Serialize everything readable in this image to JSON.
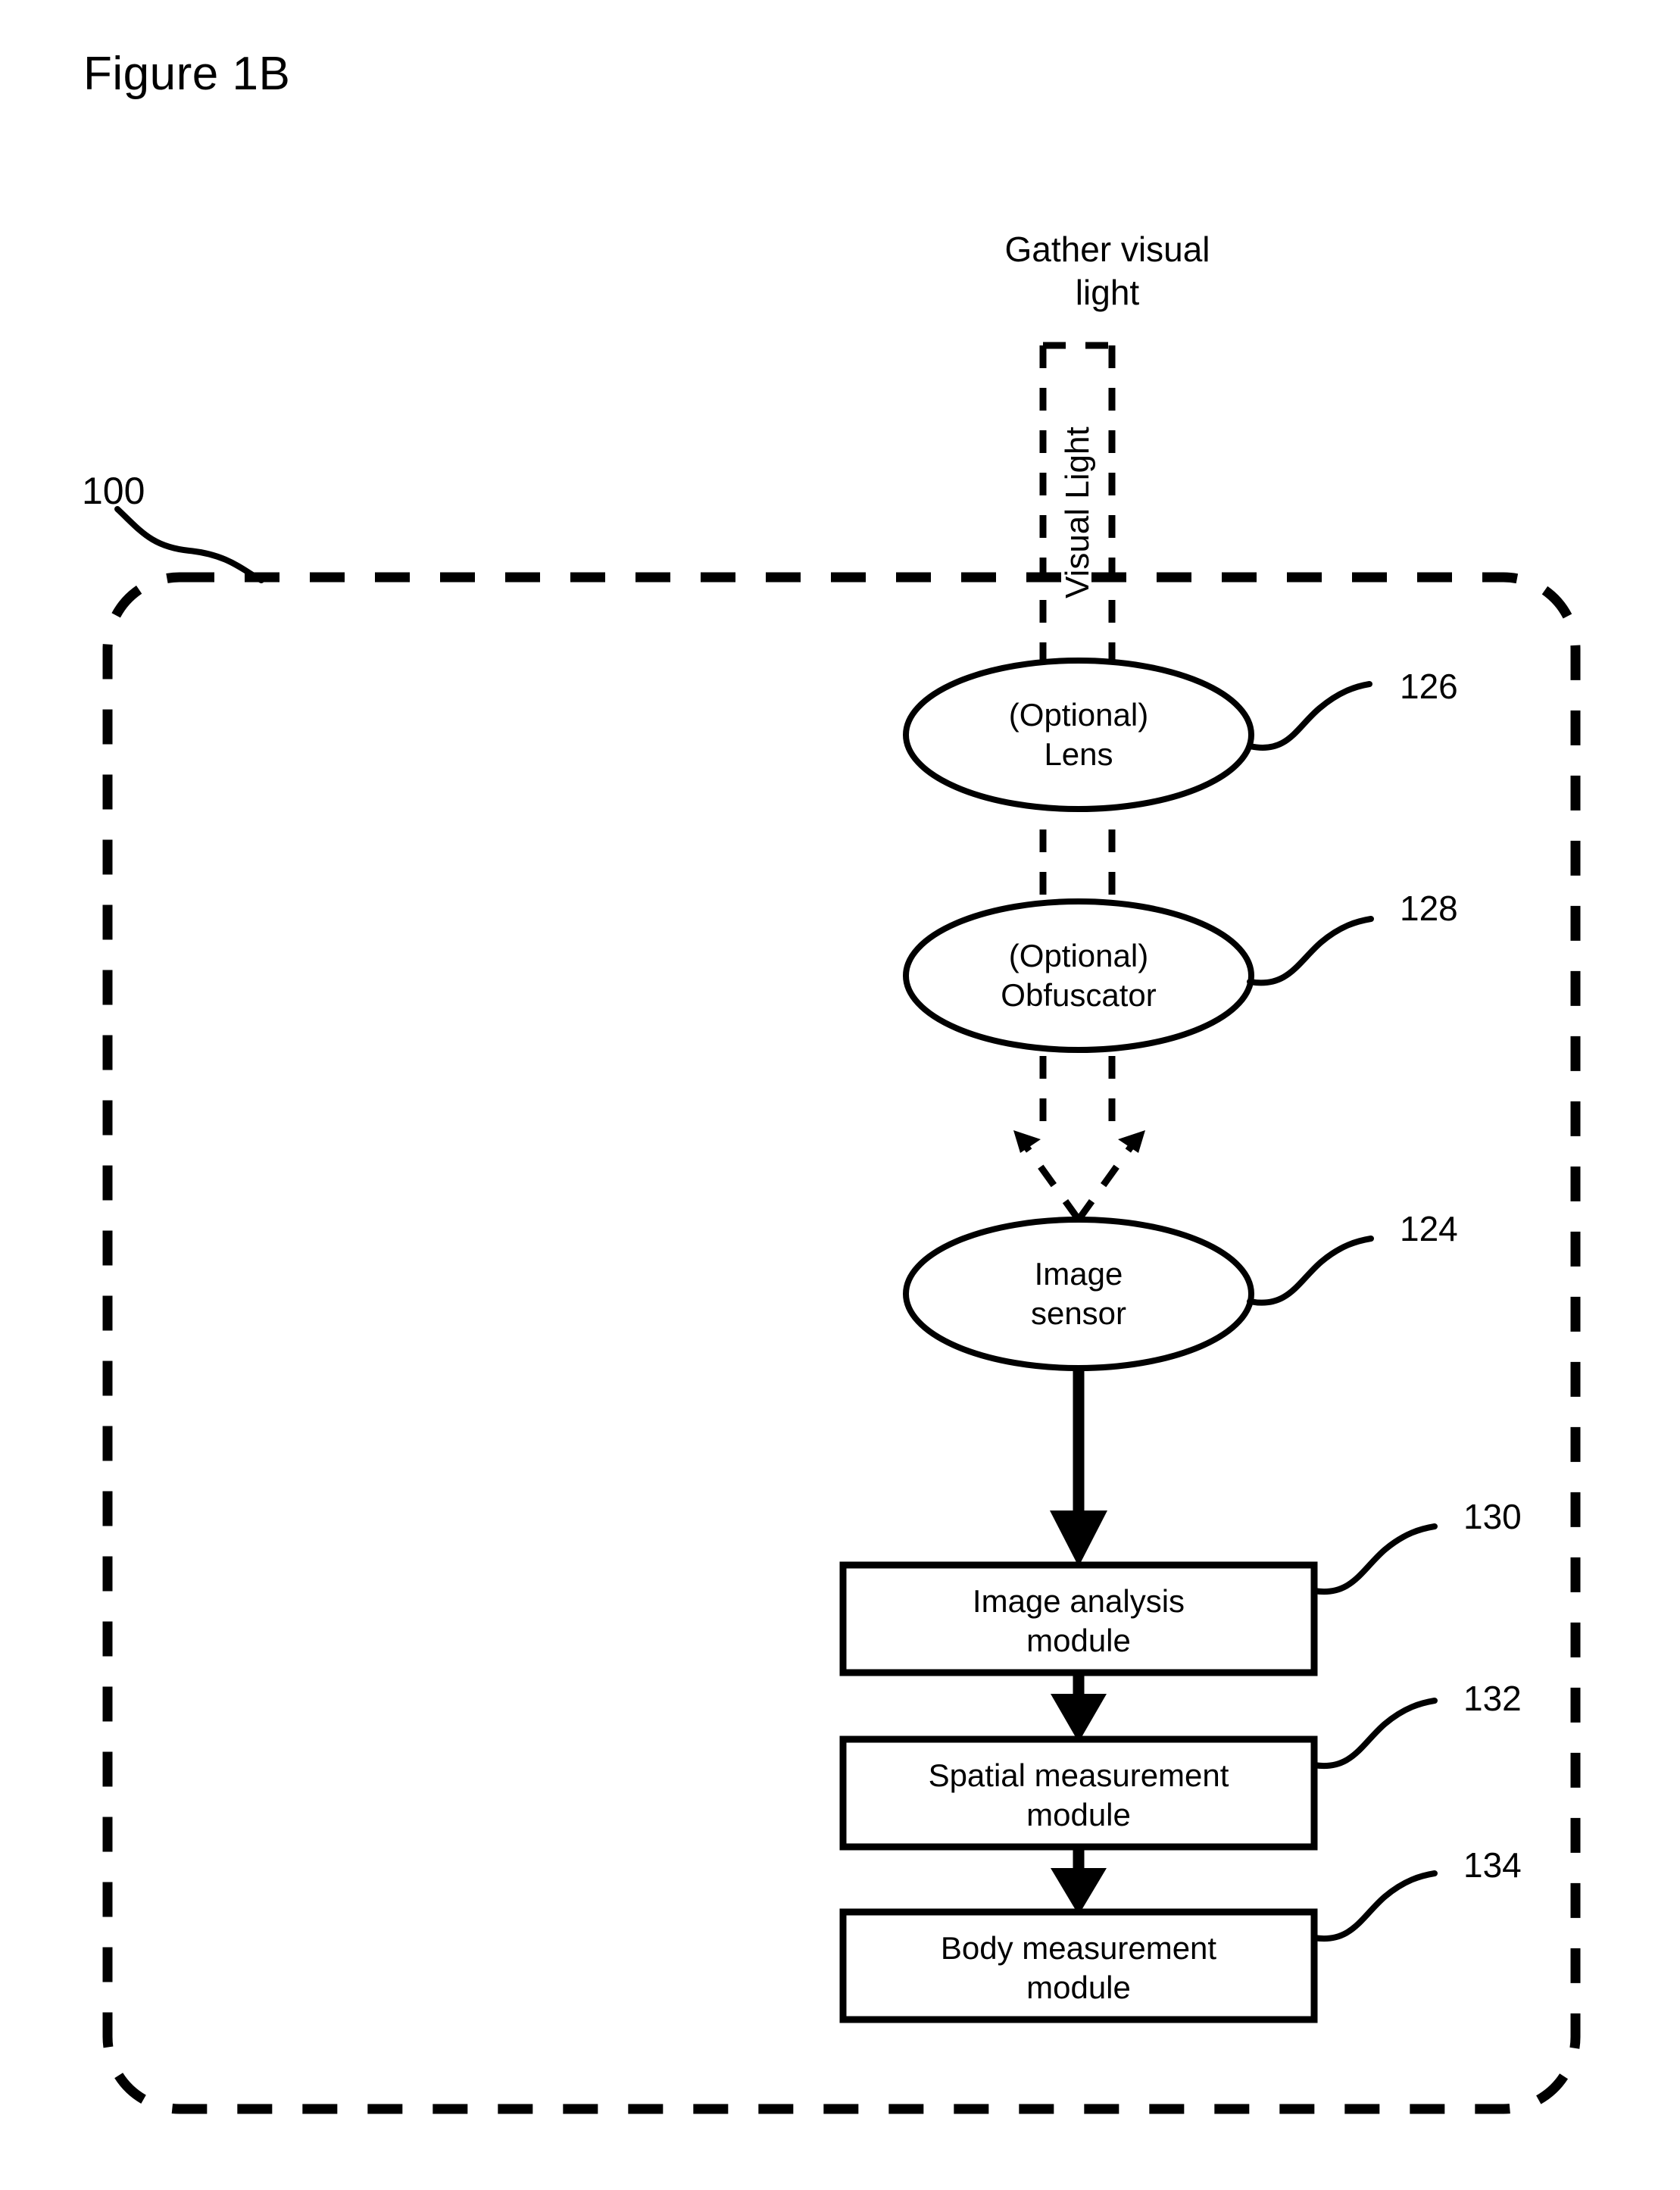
{
  "figure": {
    "title": "Figure 1B",
    "system_reference_numeral": "100"
  },
  "flow": {
    "source_label_line1": "Gather visual",
    "source_label_line2": "light",
    "channel_label": "Visual Light"
  },
  "nodes": [
    {
      "id": "lens",
      "shape": "ellipse",
      "line1": "(Optional)",
      "line2": "Lens",
      "ref": "126"
    },
    {
      "id": "obfuscator",
      "shape": "ellipse",
      "line1": "(Optional)",
      "line2": "Obfuscator",
      "ref": "128"
    },
    {
      "id": "image-sensor",
      "shape": "ellipse",
      "line1": "Image",
      "line2": "sensor",
      "ref": "124"
    },
    {
      "id": "image-analysis-module",
      "shape": "rect",
      "line1": "Image analysis",
      "line2": "module",
      "ref": "130"
    },
    {
      "id": "spatial-measurement-module",
      "shape": "rect",
      "line1": "Spatial measurement",
      "line2": "module",
      "ref": "132"
    },
    {
      "id": "body-measurement-module",
      "shape": "rect",
      "line1": "Body measurement",
      "line2": "module",
      "ref": "134"
    }
  ],
  "colors": {
    "stroke": "#000000",
    "background": "#ffffff"
  }
}
